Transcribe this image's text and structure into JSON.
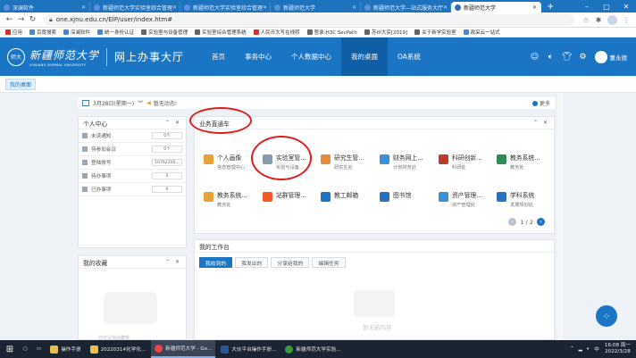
{
  "browser": {
    "tabs": [
      {
        "label": "深澜软件"
      },
      {
        "label": "新疆师范大学实验室综合管理"
      },
      {
        "label": "新疆师范大学实验室综合管理"
      },
      {
        "label": "新疆师范大学"
      },
      {
        "label": "新疆师范大学—站式服务大厅"
      },
      {
        "label": "新疆师范大学"
      }
    ],
    "active_tab": 5,
    "url": "one.xjnu.edu.cn/EIP/user/index.htm#",
    "bookmarks": [
      "应用",
      "百度搜索",
      "深澜软件",
      "统一身份认证",
      "实验室与设备管理",
      "实验室综合管理系统",
      "人民币大写在线转",
      "登录-H3C SecPath",
      "苏州大实[2019]",
      "关于新学实验室",
      "政采云一站式"
    ]
  },
  "site": {
    "logo_seal": "师大",
    "logo_cn": "新疆师范大学",
    "logo_en": "XINJIANG NORMAL UNIVERSITY",
    "hall_title": "网上办事大厅",
    "nav": [
      {
        "label": "首页"
      },
      {
        "label": "事务中心"
      },
      {
        "label": "个人数据中心"
      },
      {
        "label": "我的桌面"
      },
      {
        "label": "OA系统"
      }
    ],
    "nav_active": 3,
    "username": "董永德",
    "subnav_tab": "我的桌面"
  },
  "datebar": {
    "date": "3月28日(星期一)",
    "notice": "暂无动态!",
    "more": "更多"
  },
  "personal_center": {
    "title": "个人中心",
    "rows": [
      {
        "label": "未读通知",
        "value": "0个"
      },
      {
        "label": "待参加会议",
        "value": "0个"
      },
      {
        "label": "登陆账号",
        "value": "10762200..."
      },
      {
        "label": "待办事项",
        "value": "0"
      },
      {
        "label": "已办事项",
        "value": "0"
      }
    ]
  },
  "favorites": {
    "title": "我的收藏",
    "empty": "您还没有收藏哦"
  },
  "business": {
    "title": "业务直通车",
    "items": [
      {
        "name": "个人画像",
        "sub": "信息管理中心",
        "color": "#e8a33c"
      },
      {
        "name": "实验室管...",
        "sub": "实验与设备...",
        "color": "#8a9bb0"
      },
      {
        "name": "研究生管...",
        "sub": "研究生处",
        "color": "#e88a3c"
      },
      {
        "name": "财务网上...",
        "sub": "计划财务处",
        "color": "#3a8fd6"
      },
      {
        "name": "科研创新...",
        "sub": "科研处",
        "color": "#c0392b"
      },
      {
        "name": "教务系统...",
        "sub": "教务处",
        "color": "#2e8b57"
      },
      {
        "name": "教务系统...",
        "sub": "教务处",
        "color": "#e8a33c"
      },
      {
        "name": "站群管理...",
        "sub": "",
        "color": "#f05a28"
      },
      {
        "name": "教工邮箱",
        "sub": "",
        "color": "#1a76c4"
      },
      {
        "name": "图书馆",
        "sub": "",
        "color": "#2a6fbe"
      },
      {
        "name": "资产管理...",
        "sub": "资产管理处",
        "color": "#3a8fd6"
      },
      {
        "name": "学科系统",
        "sub": "发展规划处",
        "color": "#2a6fbe"
      }
    ],
    "page": "1 / 2"
  },
  "workbench": {
    "title": "我的工作台",
    "tabs": [
      "我收到的",
      "我发出的",
      "分享给我的",
      "编辑任务"
    ],
    "empty": "暂无新内容"
  },
  "taskbar": {
    "items": [
      "操作手册",
      "20220314化学化...",
      "新疆师范大学 - Go...",
      "大伙平台操作手册...",
      "新疆师范大学实验..."
    ],
    "active": 2,
    "time": "16:08 周一",
    "date": "2022/3/28"
  }
}
